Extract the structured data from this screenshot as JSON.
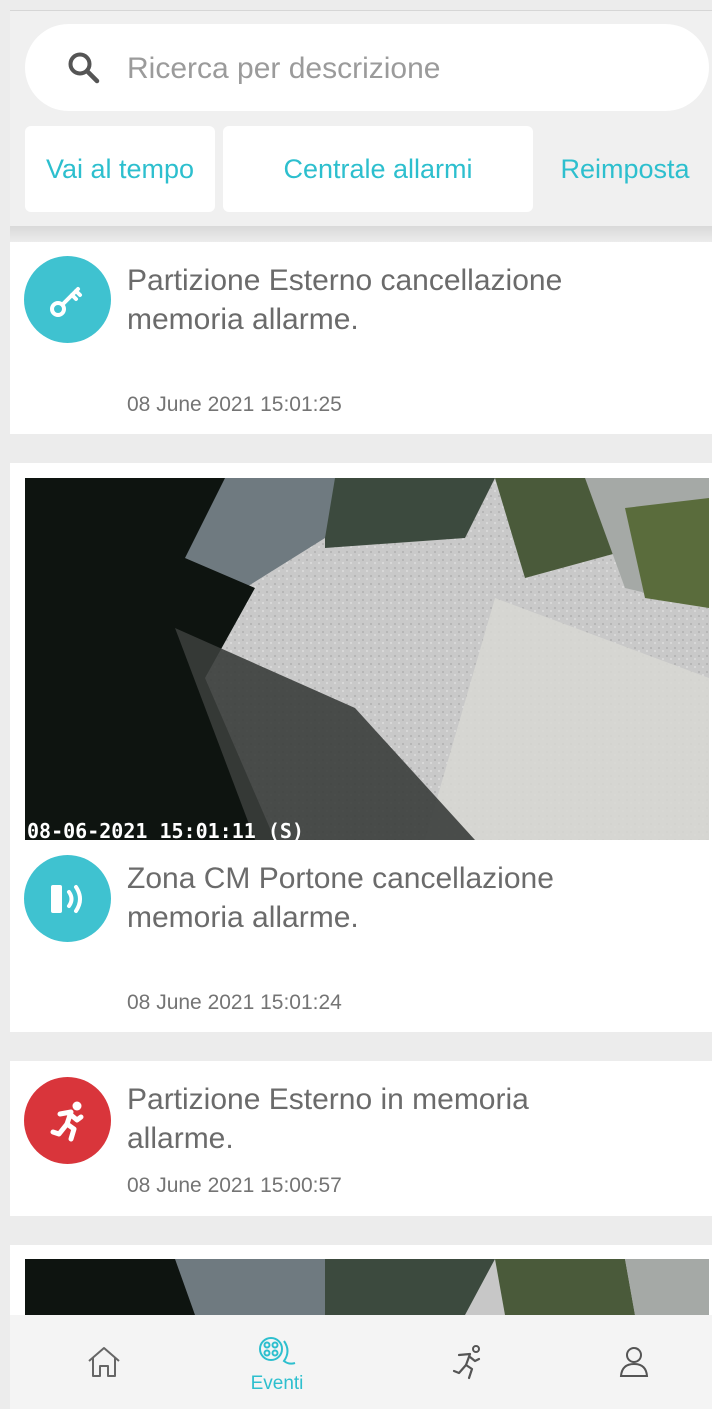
{
  "search": {
    "placeholder": "Ricerca per descrizione",
    "icon": "search-icon"
  },
  "filters": {
    "goto_time_label": "Vai al tempo",
    "alarm_center_label": "Centrale allarmi",
    "reset_label": "Reimposta"
  },
  "colors": {
    "accent": "#2dbfce",
    "icon_teal": "#3fc2d0",
    "icon_red": "#d9353b"
  },
  "events": [
    {
      "icon": "key-icon",
      "title": "Partizione Esterno cancellazione memoria allarme.",
      "time": "08 June 2021 15:01:25",
      "has_snapshot": false
    },
    {
      "icon": "sensor-icon",
      "title": "Zona CM Portone cancellazione memoria allarme.",
      "time": "08 June 2021 15:01:24",
      "has_snapshot": true,
      "snapshot_timestamp": "08-06-2021 15:01:11 (S)"
    },
    {
      "icon": "running-person-icon",
      "title": "Partizione Esterno in memoria allarme.",
      "time": "08 June 2021 15:00:57",
      "has_snapshot": false
    },
    {
      "has_snapshot": true
    }
  ],
  "bottom_nav": {
    "items": [
      {
        "icon": "home-icon",
        "label": ""
      },
      {
        "icon": "events-icon",
        "label": "Eventi",
        "active": true
      },
      {
        "icon": "running-person-icon",
        "label": ""
      },
      {
        "icon": "user-icon",
        "label": ""
      }
    ]
  }
}
